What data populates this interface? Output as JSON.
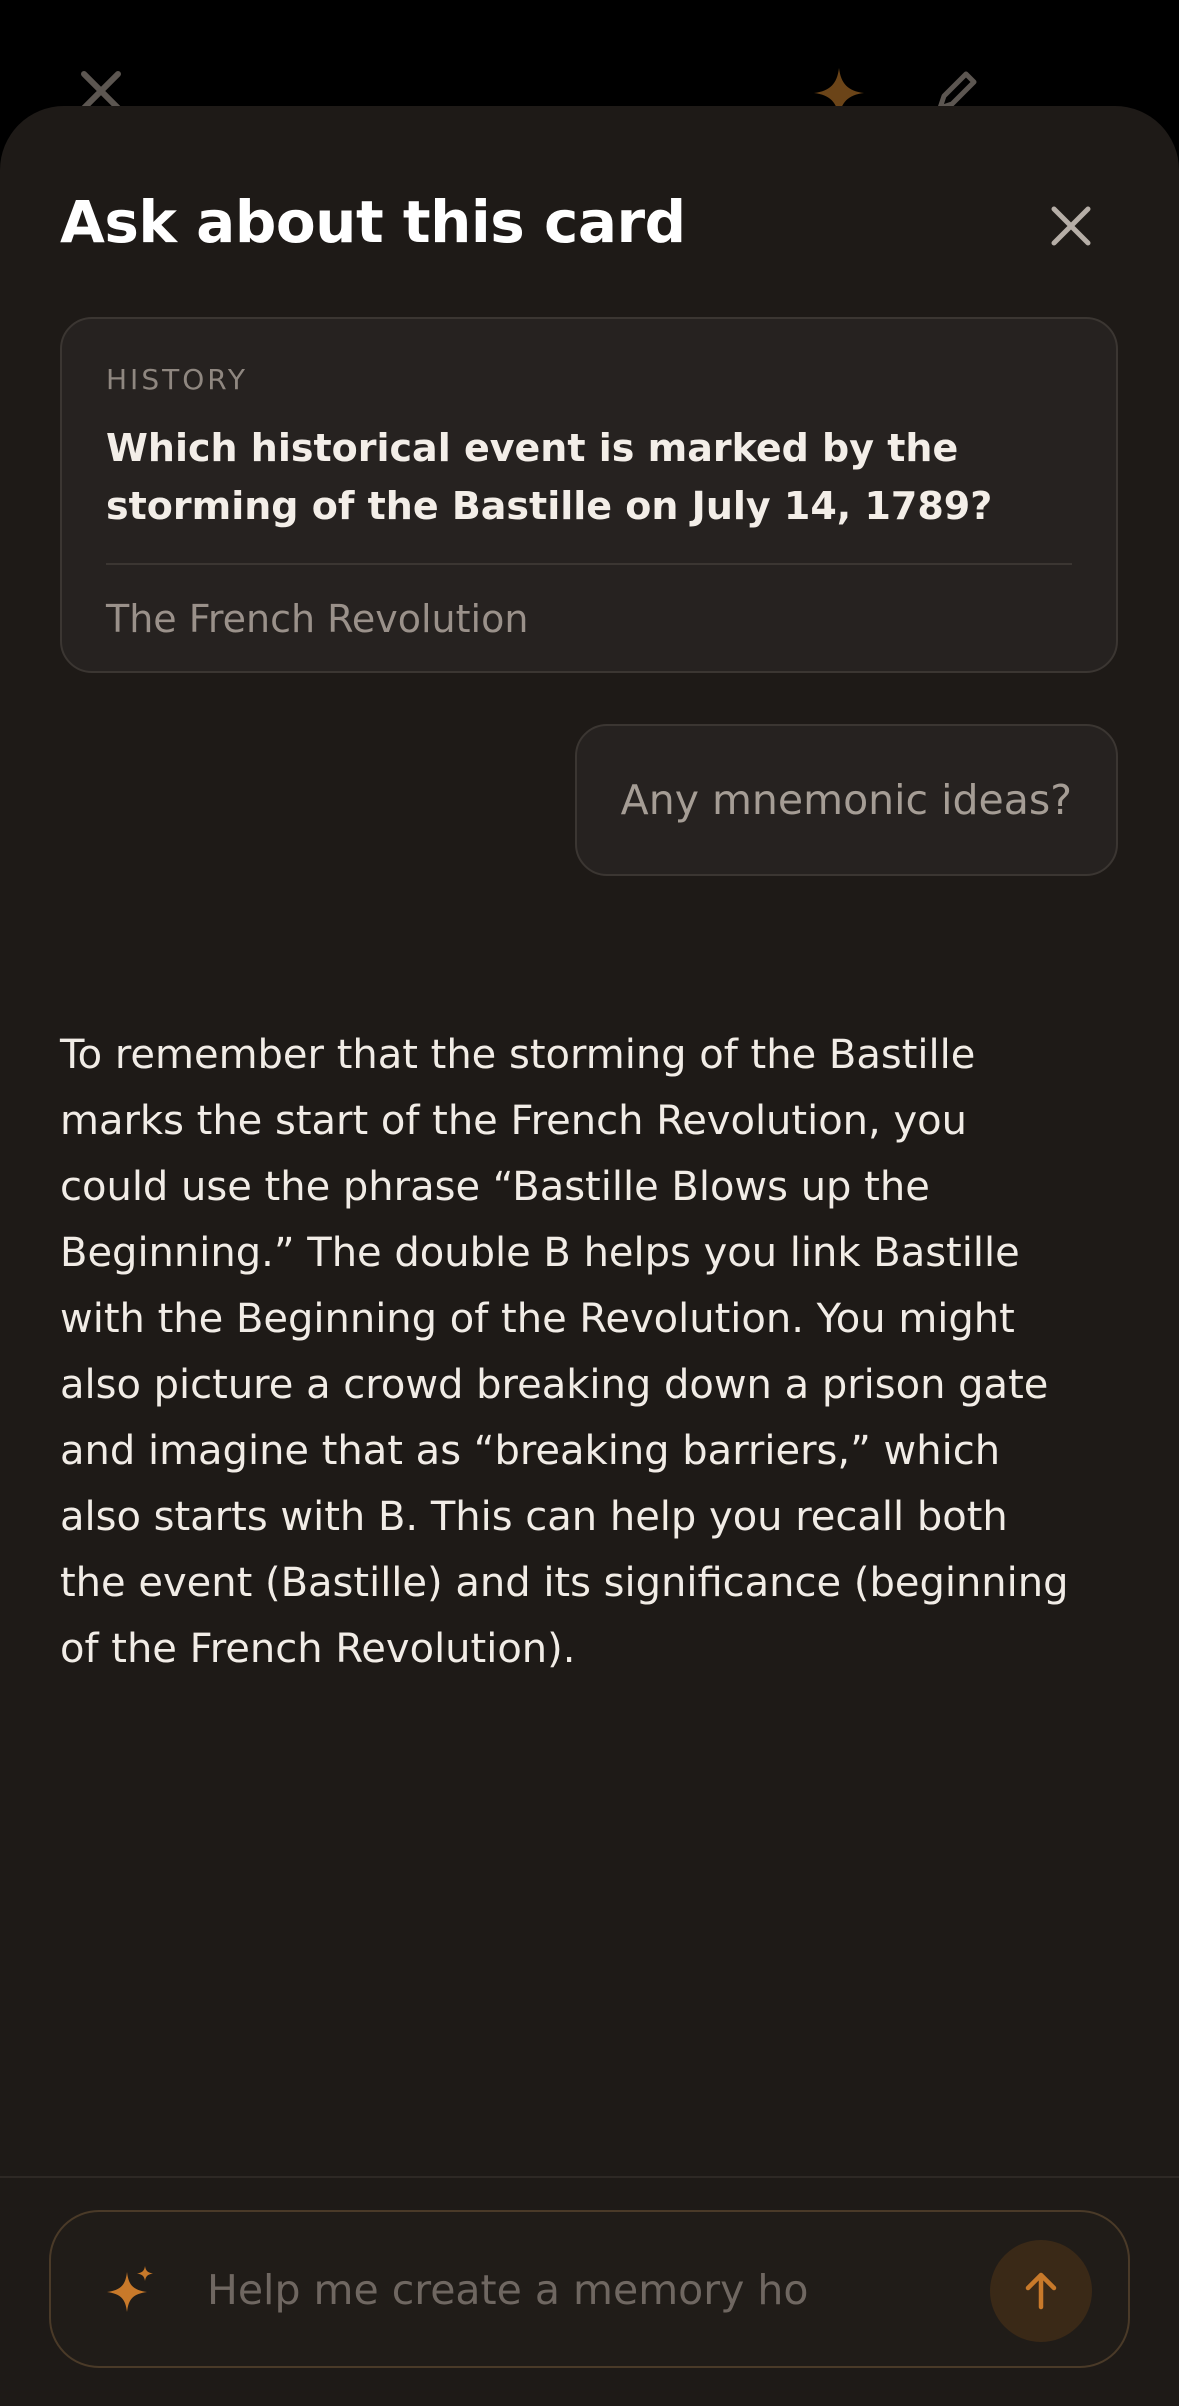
{
  "background_toolbar": {
    "close_icon": "close-icon",
    "sparkle_icon": "sparkle-icon",
    "edit_icon": "pencil-icon"
  },
  "sheet": {
    "title": "Ask about this card",
    "close_icon": "close-icon"
  },
  "card": {
    "category": "HISTORY",
    "question": "Which historical event is marked by the storming of the Bastille on July 14, 1789?",
    "answer": "The French Revolution"
  },
  "conversation": {
    "user_message": "Any mnemonic ideas?",
    "assistant_message": "To remember that the storming of the Bastille marks the start of the French Revolution, you could use the phrase “Bastille Blows up the Beginning.” The double B helps you link Bastille with the Beginning of the Revolution. You might also picture a crowd breaking down a prison gate and imagine that as “breaking barriers,” which also starts with B. This can help you recall both the event (Bastille) and its significance (beginning of the French Revolution)."
  },
  "composer": {
    "placeholder": "Help me create a memory hook",
    "value": "",
    "sparkle_icon": "sparkle-icon",
    "send_icon": "arrow-up-icon"
  },
  "colors": {
    "accent": "#c8792a",
    "sheet_background": "#1e1a17",
    "card_background": "#262220"
  }
}
